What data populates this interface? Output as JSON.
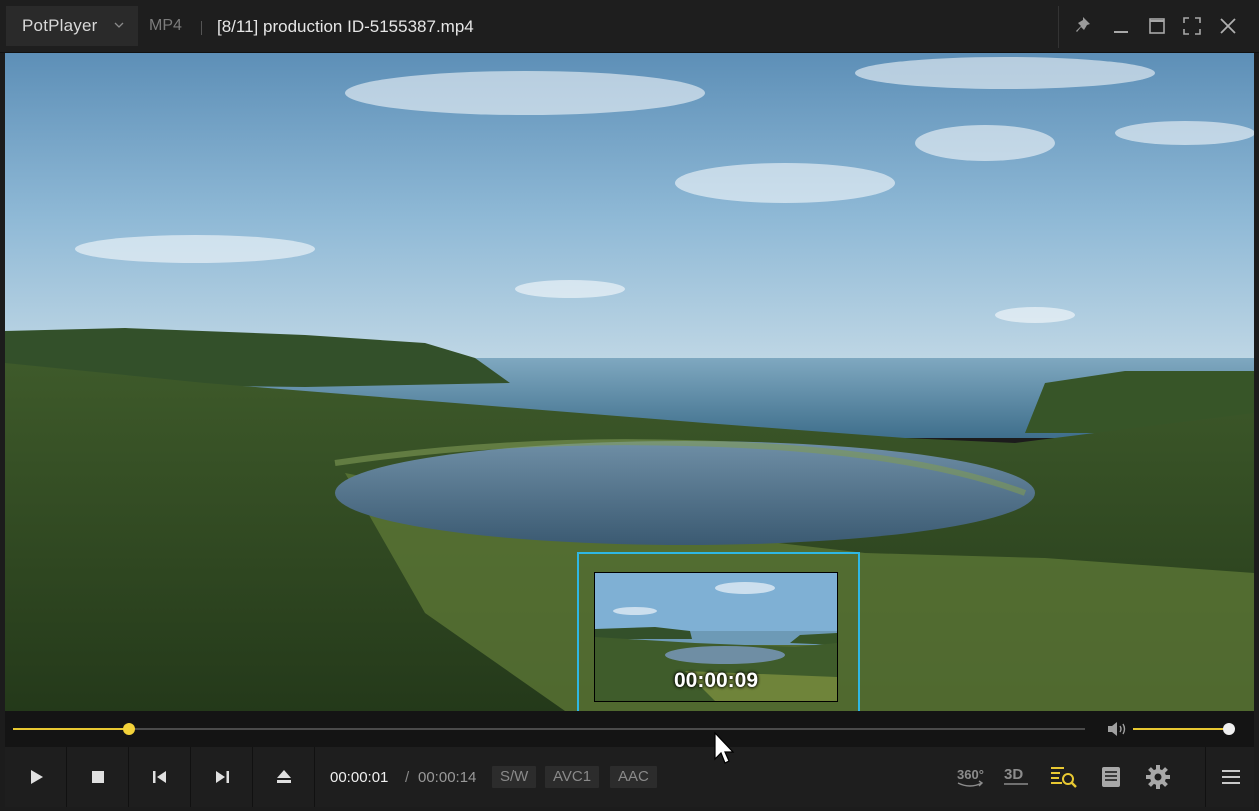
{
  "titlebar": {
    "app_name": "PotPlayer",
    "format": "MP4",
    "file_title": "[8/11] production ID-5155387.mp4"
  },
  "preview": {
    "timestamp": "00:00:09"
  },
  "seek": {
    "progress_fraction": 0.108
  },
  "volume": {
    "level_fraction": 1.0
  },
  "playback": {
    "current_time": "00:00:01",
    "separator": "/",
    "duration": "00:00:14"
  },
  "tags": {
    "decoder": "S/W",
    "video_codec": "AVC1",
    "audio_codec": "AAC"
  },
  "colors": {
    "accent": "#e8c832",
    "preview_border": "#2fb7e3"
  },
  "icons": [
    "chevron-down-icon",
    "pin-icon",
    "minimize-icon",
    "maximize-icon",
    "fullscreen-icon",
    "close-icon",
    "play-icon",
    "stop-icon",
    "previous-icon",
    "next-icon",
    "eject-icon",
    "volume-icon",
    "360-icon",
    "3d-icon",
    "playlist-search-icon",
    "chapter-icon",
    "settings-gear-icon",
    "menu-icon"
  ],
  "right_buttons": {
    "vr": "360°",
    "stereo": "3D"
  }
}
